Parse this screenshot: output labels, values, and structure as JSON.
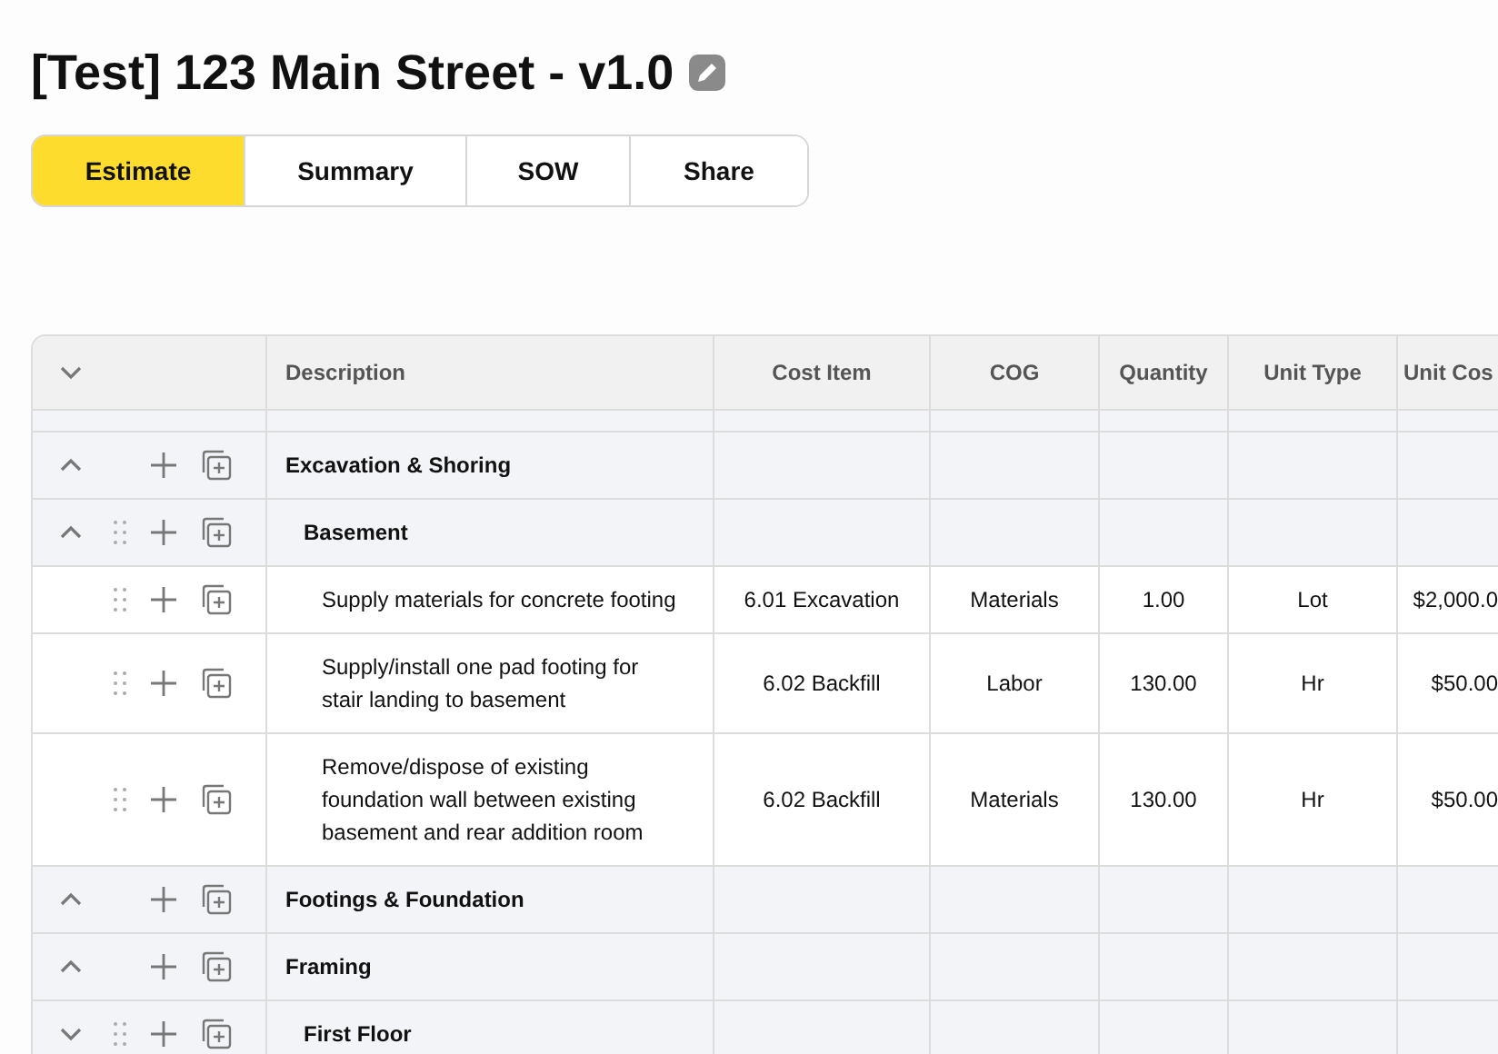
{
  "title": "[Test] 123 Main Street - v1.0",
  "tabs": [
    {
      "label": "Estimate",
      "selected": true
    },
    {
      "label": "Summary",
      "selected": false
    },
    {
      "label": "SOW",
      "selected": false
    },
    {
      "label": "Share",
      "selected": false
    }
  ],
  "table": {
    "header_expanded": false,
    "columns": [
      "Description",
      "Cost Item",
      "COG",
      "Quantity",
      "Unit Type",
      "Unit Cos"
    ],
    "rows": [
      {
        "kind": "group",
        "description": "Excavation & Shoring",
        "expanded": true,
        "children": [
          {
            "kind": "subgroup",
            "description": "Basement",
            "expanded": true,
            "children": [
              {
                "kind": "item",
                "description": "Supply materials for concrete footing",
                "cost_item": "6.01 Excavation",
                "cog": "Materials",
                "quantity": "1.00",
                "unit_type": "Lot",
                "unit_cost": "$2,000.0"
              },
              {
                "kind": "item",
                "description": "Supply/install one pad footing for stair landing to basement",
                "cost_item": "6.02 Backfill",
                "cog": "Labor",
                "quantity": "130.00",
                "unit_type": "Hr",
                "unit_cost": "$50.00"
              },
              {
                "kind": "item",
                "description": "Remove/dispose of existing foundation wall between existing basement and rear addition room",
                "cost_item": "6.02 Backfill",
                "cog": "Materials",
                "quantity": "130.00",
                "unit_type": "Hr",
                "unit_cost": "$50.00"
              }
            ]
          }
        ]
      },
      {
        "kind": "group",
        "description": "Footings & Foundation",
        "expanded": true
      },
      {
        "kind": "group",
        "description": "Framing",
        "expanded": true,
        "children": [
          {
            "kind": "subgroup",
            "description": "First Floor",
            "expanded": false
          }
        ]
      }
    ]
  }
}
